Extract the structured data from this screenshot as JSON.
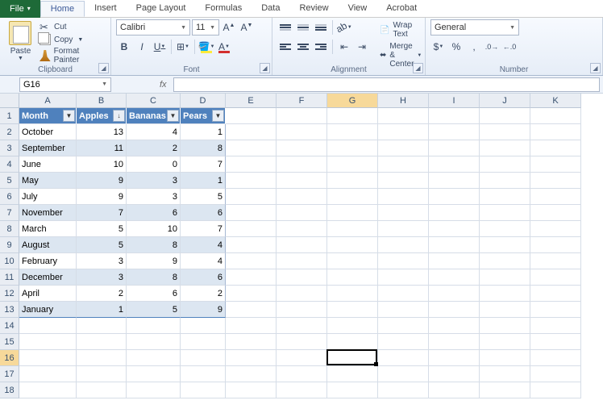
{
  "tabs": {
    "file": "File",
    "items": [
      "Home",
      "Insert",
      "Page Layout",
      "Formulas",
      "Data",
      "Review",
      "View",
      "Acrobat"
    ],
    "active": "Home"
  },
  "clipboard": {
    "paste": "Paste",
    "cut": "Cut",
    "copy": "Copy",
    "format_painter": "Format Painter",
    "group": "Clipboard"
  },
  "font": {
    "name": "Calibri",
    "size": "11",
    "group": "Font"
  },
  "alignment": {
    "wrap": "Wrap Text",
    "merge": "Merge & Center",
    "group": "Alignment"
  },
  "number": {
    "format": "General",
    "group": "Number"
  },
  "namebox": "G16",
  "fx_label": "fx",
  "columns": [
    "A",
    "B",
    "C",
    "D",
    "E",
    "F",
    "G",
    "H",
    "I",
    "J",
    "K"
  ],
  "headers": [
    "Month",
    "Apples",
    "Bananas",
    "Pears"
  ],
  "rows": [
    {
      "m": "October",
      "a": 13,
      "b": 4,
      "p": 1
    },
    {
      "m": "September",
      "a": 11,
      "b": 2,
      "p": 8
    },
    {
      "m": "June",
      "a": 10,
      "b": 0,
      "p": 7
    },
    {
      "m": "May",
      "a": 9,
      "b": 3,
      "p": 1
    },
    {
      "m": "July",
      "a": 9,
      "b": 3,
      "p": 5
    },
    {
      "m": "November",
      "a": 7,
      "b": 6,
      "p": 6
    },
    {
      "m": "March",
      "a": 5,
      "b": 10,
      "p": 7
    },
    {
      "m": "August",
      "a": 5,
      "b": 8,
      "p": 4
    },
    {
      "m": "February",
      "a": 3,
      "b": 9,
      "p": 4
    },
    {
      "m": "December",
      "a": 3,
      "b": 8,
      "p": 6
    },
    {
      "m": "April",
      "a": 2,
      "b": 6,
      "p": 2
    },
    {
      "m": "January",
      "a": 1,
      "b": 5,
      "p": 9
    }
  ],
  "active_cell": "G16",
  "total_rows": 18,
  "chart_data": {
    "type": "table",
    "columns": [
      "Month",
      "Apples",
      "Bananas",
      "Pears"
    ],
    "data": [
      [
        "October",
        13,
        4,
        1
      ],
      [
        "September",
        11,
        2,
        8
      ],
      [
        "June",
        10,
        0,
        7
      ],
      [
        "May",
        9,
        3,
        1
      ],
      [
        "July",
        9,
        3,
        5
      ],
      [
        "November",
        7,
        6,
        6
      ],
      [
        "March",
        5,
        10,
        7
      ],
      [
        "August",
        5,
        8,
        4
      ],
      [
        "February",
        3,
        9,
        4
      ],
      [
        "December",
        3,
        8,
        6
      ],
      [
        "April",
        2,
        6,
        2
      ],
      [
        "January",
        1,
        5,
        9
      ]
    ],
    "sorted_by": "Apples",
    "sort_order": "desc"
  }
}
